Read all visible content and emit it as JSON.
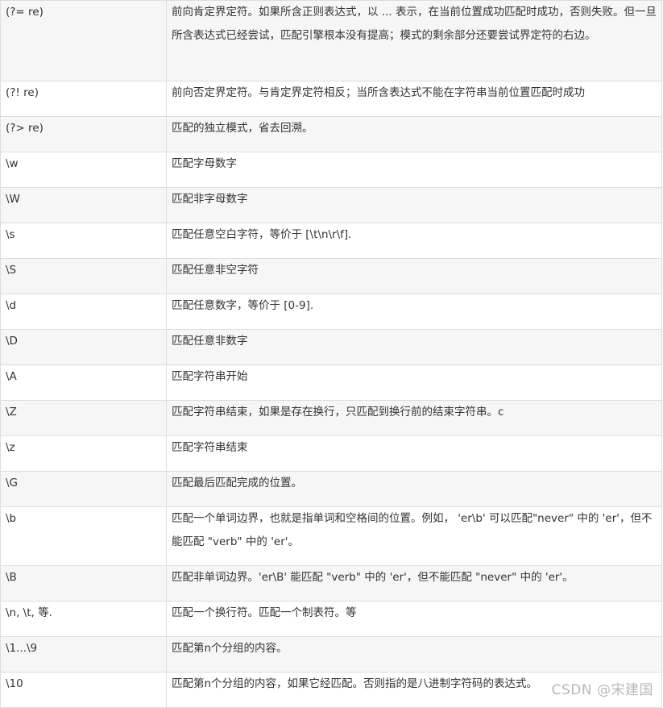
{
  "rows": [
    {
      "pattern": "(?= re)",
      "description": "前向肯定界定符。如果所含正则表达式，以 ... 表示，在当前位置成功匹配时成功，否则失败。但一旦所含表达式已经尝试，匹配引擎根本没有提高；模式的剩余部分还要尝试界定符的右边。"
    },
    {
      "pattern": "(?! re)",
      "description": "前向否定界定符。与肯定界定符相反；当所含表达式不能在字符串当前位置匹配时成功"
    },
    {
      "pattern": "(?> re)",
      "description": "匹配的独立模式，省去回溯。"
    },
    {
      "pattern": "\\w",
      "description": "匹配字母数字"
    },
    {
      "pattern": "\\W",
      "description": "匹配非字母数字"
    },
    {
      "pattern": "\\s",
      "description": "匹配任意空白字符，等价于 [\\t\\n\\r\\f]."
    },
    {
      "pattern": "\\S",
      "description": "匹配任意非空字符"
    },
    {
      "pattern": "\\d",
      "description": "匹配任意数字，等价于 [0-9]."
    },
    {
      "pattern": "\\D",
      "description": "匹配任意非数字"
    },
    {
      "pattern": "\\A",
      "description": "匹配字符串开始"
    },
    {
      "pattern": "\\Z",
      "description": "匹配字符串结束，如果是存在换行，只匹配到换行前的结束字符串。c"
    },
    {
      "pattern": "\\z",
      "description": "匹配字符串结束"
    },
    {
      "pattern": "\\G",
      "description": "匹配最后匹配完成的位置。"
    },
    {
      "pattern": "\\b",
      "description": "匹配一个单词边界，也就是指单词和空格间的位置。例如， 'er\\b' 可以匹配\"never\" 中的 'er'，但不能匹配 \"verb\" 中的 'er'。"
    },
    {
      "pattern": "\\B",
      "description": "匹配非单词边界。'er\\B' 能匹配 \"verb\" 中的 'er'，但不能匹配 \"never\" 中的 'er'。"
    },
    {
      "pattern": "\\n, \\t, 等.",
      "description": "匹配一个换行符。匹配一个制表符。等"
    },
    {
      "pattern": "\\1...\\9",
      "description": "匹配第n个分组的内容。"
    },
    {
      "pattern": "\\10",
      "description": "匹配第n个分组的内容，如果它经匹配。否则指的是八进制字符码的表达式。"
    }
  ],
  "watermark": "CSDN @宋建国"
}
